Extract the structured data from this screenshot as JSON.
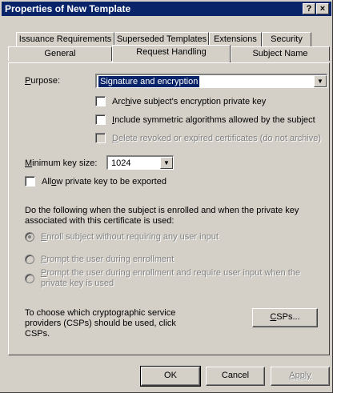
{
  "window": {
    "title": "Properties of New Template",
    "help_glyph": "?",
    "close_glyph": "×"
  },
  "tabs_row1": [
    {
      "label": "Issuance Requirements"
    },
    {
      "label": "Superseded Templates"
    },
    {
      "label": "Extensions"
    },
    {
      "label": "Security"
    }
  ],
  "tabs_row2": [
    {
      "label": "General"
    },
    {
      "label": "Request Handling",
      "active": true
    },
    {
      "label": "Subject Name"
    }
  ],
  "purpose": {
    "label_u": "P",
    "label_rest": "urpose:",
    "value": "Signature and encryption"
  },
  "options": {
    "archive": {
      "pre": "Arc",
      "u": "h",
      "post": "ive subject's encryption private key",
      "checked": false
    },
    "include": {
      "pre": "",
      "u": "I",
      "post": "nclude symmetric algorithms allowed by the subject",
      "checked": false
    },
    "delete": {
      "pre": "",
      "u": "D",
      "post": "elete revoked or expired certificates (do not archive)",
      "checked": false,
      "disabled": true
    }
  },
  "min_key": {
    "label_u": "M",
    "label_rest": "inimum key size:",
    "value": "1024"
  },
  "allow_export": {
    "pre": "All",
    "u": "o",
    "post": "w private key to be exported",
    "checked": false
  },
  "enroll_intro": "Do the following when the subject is enrolled and when the private key associated with this certificate is used:",
  "enroll_options": [
    {
      "u": "E",
      "rest": "nroll subject without requiring any user input",
      "selected": true
    },
    {
      "u": "P",
      "rest": "rompt the user during enrollment",
      "selected": false
    },
    {
      "u": "P",
      "rest": "rompt the user during enrollment and require user input when the private key is used",
      "selected": false
    }
  ],
  "csp": {
    "text": "To choose which cryptographic service providers (CSPs) should be used, click CSPs.",
    "button_u": "C",
    "button_rest": "SPs..."
  },
  "buttons": {
    "ok": "OK",
    "cancel": "Cancel",
    "apply": "Apply"
  }
}
